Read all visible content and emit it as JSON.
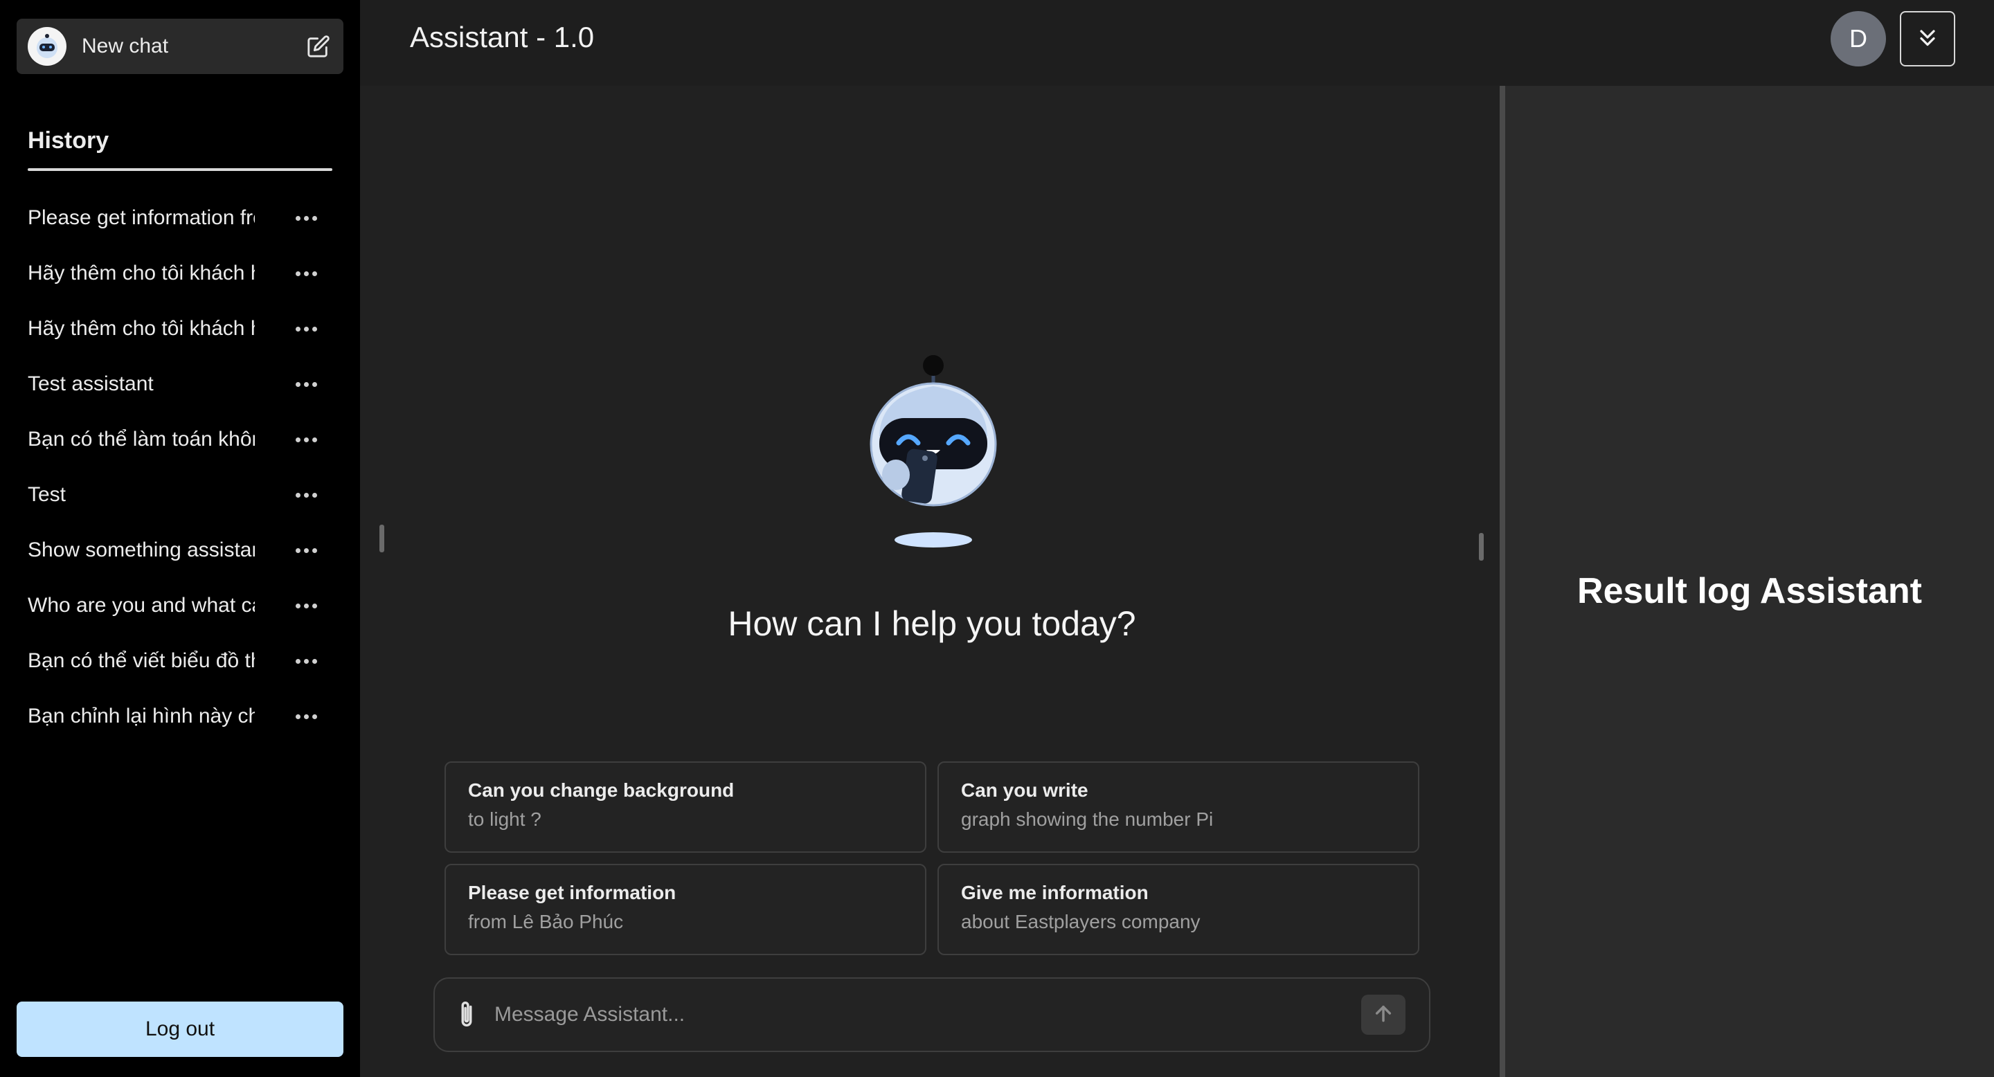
{
  "sidebar": {
    "new_chat_label": "New chat",
    "history_title": "History",
    "items": [
      {
        "label": "Please get information from Lê Bảo Phúc"
      },
      {
        "label": "Hãy thêm cho tôi khách hàng"
      },
      {
        "label": "Hãy thêm cho tôi khách hàng"
      },
      {
        "label": "Test assistant"
      },
      {
        "label": "Bạn có thể làm toán không"
      },
      {
        "label": "Test"
      },
      {
        "label": "Show something assistant"
      },
      {
        "label": "Who are you and what can you do"
      },
      {
        "label": "Bạn có thể viết biểu đồ thị"
      },
      {
        "label": "Bạn chỉnh lại hình này cho tôi"
      }
    ],
    "logout_label": "Log out"
  },
  "header": {
    "title": "Assistant - 1.0",
    "avatar_initial": "D"
  },
  "main": {
    "greeting": "How can I help you today?",
    "suggestions": [
      {
        "title": "Can you change background",
        "subtitle": "to light ?"
      },
      {
        "title": "Can you write",
        "subtitle": "graph showing the number Pi"
      },
      {
        "title": "Please get information",
        "subtitle": "from Lê Bảo Phúc"
      },
      {
        "title": "Give me information",
        "subtitle": "about Eastplayers company"
      }
    ],
    "input": {
      "placeholder": "Message Assistant...",
      "value": ""
    }
  },
  "right_panel": {
    "title": "Result log Assistant"
  },
  "colors": {
    "sidebar_bg": "#000000",
    "main_bg": "#212121",
    "panel_bg": "#2b2b2b",
    "logout_bg": "#bfe3ff",
    "robot_accent": "#6fb3ff"
  },
  "icons": {
    "logo": "robot-logo-icon",
    "new_chat": "edit-icon",
    "more": "more-dots-icon",
    "collapse": "double-chevron-down-icon",
    "attach": "paperclip-icon",
    "send": "arrow-up-icon"
  }
}
